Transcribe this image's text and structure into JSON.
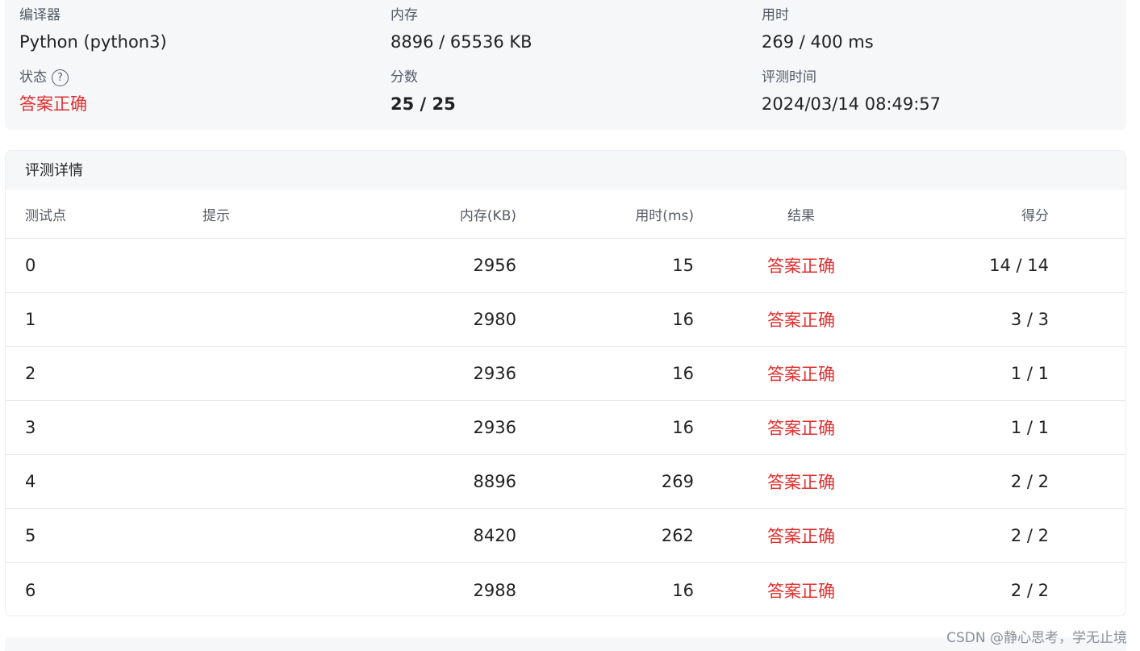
{
  "summary": {
    "compiler_label": "编译器",
    "compiler_value": "Python (python3)",
    "memory_label": "内存",
    "memory_value": "8896 / 65536 KB",
    "time_label": "用时",
    "time_value": "269 / 400 ms",
    "status_label": "状态",
    "status_help_icon": "question-circle-icon",
    "status_value": "答案正确",
    "score_label": "分数",
    "score_value": "25 / 25",
    "judge_time_label": "评测时间",
    "judge_time_value": "2024/03/14 08:49:57"
  },
  "detail": {
    "title": "评测详情",
    "columns": {
      "case": "测试点",
      "hint": "提示",
      "memory": "内存(KB)",
      "time": "用时(ms)",
      "result": "结果",
      "score": "得分"
    },
    "rows": [
      {
        "case": "0",
        "hint": "",
        "memory": "2956",
        "time": "15",
        "result": "答案正确",
        "score": "14 / 14"
      },
      {
        "case": "1",
        "hint": "",
        "memory": "2980",
        "time": "16",
        "result": "答案正确",
        "score": "3 / 3"
      },
      {
        "case": "2",
        "hint": "",
        "memory": "2936",
        "time": "16",
        "result": "答案正确",
        "score": "1 / 1"
      },
      {
        "case": "3",
        "hint": "",
        "memory": "2936",
        "time": "16",
        "result": "答案正确",
        "score": "1 / 1"
      },
      {
        "case": "4",
        "hint": "",
        "memory": "8896",
        "time": "269",
        "result": "答案正确",
        "score": "2 / 2"
      },
      {
        "case": "5",
        "hint": "",
        "memory": "8420",
        "time": "262",
        "result": "答案正确",
        "score": "2 / 2"
      },
      {
        "case": "6",
        "hint": "",
        "memory": "2988",
        "time": "16",
        "result": "答案正确",
        "score": "2 / 2"
      }
    ]
  },
  "watermark": "CSDN @静心思考，学无止境",
  "colors": {
    "accepted": "#e02f2f",
    "card_bg": "#f6f7f9",
    "label": "#555b66"
  }
}
